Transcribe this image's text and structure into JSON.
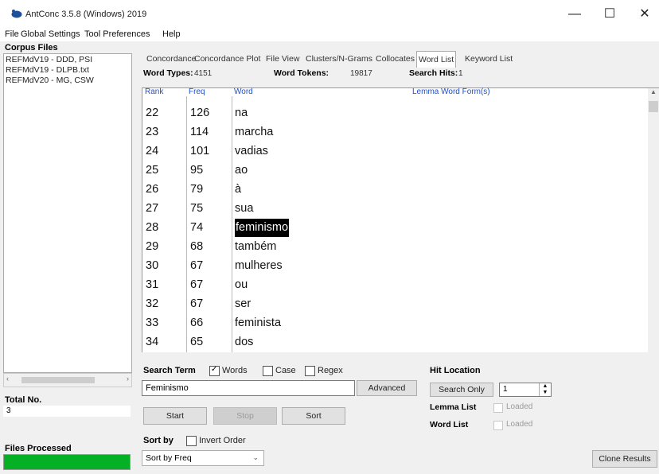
{
  "window": {
    "title": "AntConc 3.5.8 (Windows) 2019",
    "controls": {
      "minimize": "—",
      "maximize": "☐",
      "close": "✕"
    }
  },
  "menu": [
    "File",
    "Global Settings",
    "Tool Preferences",
    "Help"
  ],
  "left_panel": {
    "corpus_files_label": "Corpus Files",
    "corpus_files": [
      "REFMdV19 - DDD, PSI",
      "REFMdV19 - DLPB.txt",
      "REFMdV20 - MG, CSW"
    ],
    "total_label": "Total No.",
    "total_value": "3",
    "files_processed_label": "Files Processed",
    "files_processed_progress": 1.0
  },
  "tabs": [
    {
      "label": "Concordance",
      "active": false
    },
    {
      "label": "Concordance Plot",
      "active": false
    },
    {
      "label": "File View",
      "active": false
    },
    {
      "label": "Clusters/N-Grams",
      "active": false
    },
    {
      "label": "Collocates",
      "active": false
    },
    {
      "label": "Word List",
      "active": true
    },
    {
      "label": "Keyword List",
      "active": false
    }
  ],
  "stats": {
    "word_types_label": "Word Types:",
    "word_types_value": "4151",
    "word_tokens_label": "Word Tokens:",
    "word_tokens_value": "19817",
    "search_hits_label": "Search Hits:",
    "search_hits_value": "1"
  },
  "word_list": {
    "headers": {
      "rank": "Rank",
      "freq": "Freq",
      "word": "Word"
    },
    "rows": [
      {
        "rank": "22",
        "freq": "126",
        "word": "na"
      },
      {
        "rank": "23",
        "freq": "114",
        "word": "marcha"
      },
      {
        "rank": "24",
        "freq": "101",
        "word": "vadias"
      },
      {
        "rank": "25",
        "freq": "95",
        "word": "ao"
      },
      {
        "rank": "26",
        "freq": "79",
        "word": "à"
      },
      {
        "rank": "27",
        "freq": "75",
        "word": "sua"
      },
      {
        "rank": "28",
        "freq": "74",
        "word": "feminismo",
        "selected": true
      },
      {
        "rank": "29",
        "freq": "68",
        "word": "também"
      },
      {
        "rank": "30",
        "freq": "67",
        "word": "mulheres"
      },
      {
        "rank": "31",
        "freq": "67",
        "word": "ou"
      },
      {
        "rank": "32",
        "freq": "67",
        "word": "ser"
      },
      {
        "rank": "33",
        "freq": "66",
        "word": "feminista"
      },
      {
        "rank": "34",
        "freq": "65",
        "word": "dos"
      }
    ]
  },
  "lemma": {
    "header": "Lemma Word Form(s)"
  },
  "search": {
    "search_term_label": "Search Term",
    "words_label": "Words",
    "words_checked": true,
    "case_label": "Case",
    "case_checked": false,
    "regex_label": "Regex",
    "regex_checked": false,
    "term_value": "Feminismo",
    "advanced_label": "Advanced",
    "start_label": "Start",
    "stop_label": "Stop",
    "sort_label": "Sort"
  },
  "hit_location": {
    "label": "Hit Location",
    "search_only_label": "Search Only",
    "value": "1"
  },
  "lemma_list": {
    "label": "Lemma List",
    "status": "Loaded"
  },
  "word_list_status": {
    "label": "Word List",
    "status": "Loaded"
  },
  "sort": {
    "label": "Sort by",
    "invert_label": "Invert Order",
    "invert_checked": false,
    "selected": "Sort by Freq"
  },
  "clone_label": "Clone Results",
  "colors": {
    "progress": "#06b025",
    "header_blue": "#1a4fd1",
    "selection": "#000000"
  }
}
